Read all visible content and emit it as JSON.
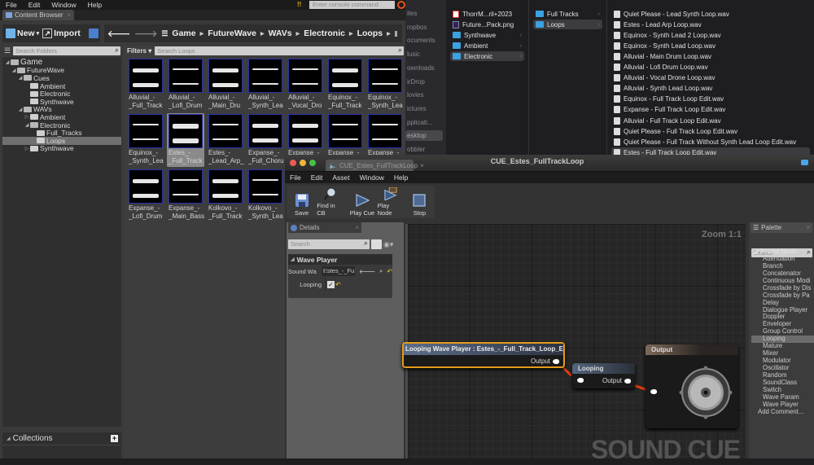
{
  "ue_menu": [
    "File",
    "Edit",
    "Window",
    "Help"
  ],
  "console_placeholder": "Enter console command",
  "content_browser_tab": "Content Browser",
  "toolbar": {
    "new_label": "New",
    "import_label": "Import"
  },
  "breadcrumb": [
    "Game",
    "FutureWave",
    "WAVs",
    "Electronic",
    "Loops"
  ],
  "folder_search_placeholder": "Search Folders",
  "filters_label": "Filters",
  "asset_search_placeholder": "Search Loops",
  "folder_tree": [
    {
      "label": "Game",
      "depth": 0,
      "expanded": true
    },
    {
      "label": "FutureWave",
      "depth": 1,
      "expanded": true
    },
    {
      "label": "Cues",
      "depth": 2,
      "expanded": true
    },
    {
      "label": "Ambient",
      "depth": 3
    },
    {
      "label": "Electronic",
      "depth": 3
    },
    {
      "label": "Synthwave",
      "depth": 3
    },
    {
      "label": "WAVs",
      "depth": 2,
      "expanded": true
    },
    {
      "label": "Ambient",
      "depth": 3,
      "collapsed": true
    },
    {
      "label": "Electronic",
      "depth": 3,
      "expanded": true
    },
    {
      "label": "Full_Tracks",
      "depth": 4
    },
    {
      "label": "Loops",
      "depth": 4,
      "selected": true
    },
    {
      "label": "Synthwave",
      "depth": 3,
      "collapsed": true
    }
  ],
  "collections_label": "Collections",
  "assets": [
    {
      "line1": "Alluvial_-",
      "line2": "_Full_Track"
    },
    {
      "line1": "Alluvial_-",
      "line2": "_Lofi_Drum"
    },
    {
      "line1": "Alluvial_-",
      "line2": "_Main_Dru"
    },
    {
      "line1": "Alluvial_-",
      "line2": "_Synth_Lea"
    },
    {
      "line1": "Alluvial_-",
      "line2": "_Vocal_Dro"
    },
    {
      "line1": "Equinox_-",
      "line2": "_Full_Track"
    },
    {
      "line1": "Equinox_-",
      "line2": "_Synth_Lea"
    },
    {
      "line1": "Equinox_-",
      "line2": "_Synth_Lea"
    },
    {
      "line1": "Estes_-",
      "line2": "_Full_Track",
      "selected": true
    },
    {
      "line1": "Estes_-",
      "line2": "_Lead_Arp_"
    },
    {
      "line1": "Expanse_-",
      "line2": "_Full_Choru"
    },
    {
      "line1": "Expanse_-",
      "line2": ""
    },
    {
      "line1": "Expanse_-",
      "line2": ""
    },
    {
      "line1": "Expanse_-",
      "line2": ""
    },
    {
      "line1": "Expanse_-",
      "line2": "_Lofi_Drum"
    },
    {
      "line1": "Expanse_-",
      "line2": "_Main_Bass"
    },
    {
      "line1": "Kolkovo_-",
      "line2": "_Full_Track"
    },
    {
      "line1": "Kolkovo_-",
      "line2": "_Synth_Lea"
    }
  ],
  "finder": {
    "sidebar": [
      "ites",
      "ropbox",
      "ocuments",
      "lusic",
      "ownloads",
      "irDrop",
      "lovies",
      "ictures",
      "pplicati...",
      "esktop",
      "obbler"
    ],
    "sidebar_selected": "esktop",
    "column1": [
      {
        "label": "ThorrM...ril+2023",
        "icon": "pdf"
      },
      {
        "label": "Future...Pack.png",
        "icon": "png"
      },
      {
        "label": "Synthwave",
        "icon": "folder",
        "chevron": true
      },
      {
        "label": "Ambient",
        "icon": "folder",
        "chevron": true
      },
      {
        "label": "Electronic",
        "icon": "folder",
        "chevron": true,
        "selected": true
      }
    ],
    "column2": [
      {
        "label": "Full Tracks",
        "icon": "folder",
        "chevron": true
      },
      {
        "label": "Loops",
        "icon": "folder",
        "chevron": true,
        "selected": true
      }
    ],
    "column3": [
      "Quiet Please - Lead Synth Loop.wav",
      "Estes - Lead Arp Loop.wav",
      "Equinox - Synth Lead 2 Loop.wav",
      "Equinox - Synth Lead Loop.wav",
      "Alluvial - Main Drum Loop.wav",
      "Alluvial - Lofi Drum Loop.wav",
      "Alluvial - Vocal Drone Loop.wav",
      "Alluvial - Synth Lead Loop.wav",
      "Equinox - Full Track Loop Edit.wav",
      "Expanse - Full Track Loop Edit.wav",
      "Alluvial - Full Track Loop Edit.wav",
      "Quiet Please - Full Track Loop Edit.wav",
      "Quiet Please - Full Track Without Synth Lead Loop Edit.wav",
      "Estes - Full Track Loop Edit.wav"
    ],
    "column3_selected": "Estes - Full Track Loop Edit.wav"
  },
  "sound_cue_editor": {
    "tab": "CUE_Estes_FullTrackLoop",
    "window_title": "CUE_Estes_FullTrackLoop",
    "menu": [
      "File",
      "Edit",
      "Asset",
      "Window",
      "Help"
    ],
    "toolbar": [
      "Save",
      "Find in CB",
      "Play Cue",
      "Play Node",
      "Stop"
    ],
    "details": {
      "tab": "Details",
      "search_placeholder": "Search",
      "section": "Wave Player",
      "props": [
        {
          "label": "Sound Wa",
          "value": "Estes_-_Fu"
        },
        {
          "label": "Looping",
          "checked": true
        }
      ]
    },
    "graph": {
      "zoom": "Zoom 1:1",
      "watermark": "SOUND CUE",
      "nodes": {
        "wave_player": {
          "title": "Looping Wave Player : Estes_-_Full_Track_Loop_Edit",
          "output": "Output"
        },
        "looping": {
          "title": "Looping",
          "output": "Output"
        },
        "output": {
          "title": "Output"
        }
      }
    },
    "palette": {
      "tab": "Palette",
      "search_placeholder": "Search",
      "category": "Sound Node",
      "items": [
        "Attenuation",
        "Branch",
        "Concatenator",
        "Continuous Modi",
        "Crossfade by Dis",
        "Crossfade by Pa",
        "Delay",
        "Dialogue Player",
        "Doppler",
        "Enveloper",
        "Group Control",
        "Looping",
        "Mature",
        "Mixer",
        "Modulator",
        "Oscillator",
        "Random",
        "SoundClass",
        "Switch",
        "Wave Param",
        "Wave Player"
      ],
      "selected": "Looping",
      "add_comment": "Add Comment..."
    }
  },
  "colors": {
    "accent_orange": "#e59b1b",
    "wire_red": "#e63b10",
    "folder_blue": "#3aa2e0",
    "thumb_border": "#2733a8"
  }
}
